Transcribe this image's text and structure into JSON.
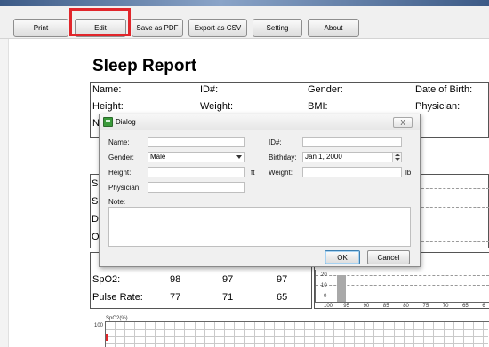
{
  "toolbar": {
    "print": "Print",
    "edit": "Edit",
    "save_pdf": "Save as PDF",
    "export_csv": "Export as CSV",
    "setting": "Setting",
    "about": "About"
  },
  "report": {
    "title": "Sleep Report",
    "info": {
      "name": "Name:",
      "id": "ID#:",
      "gender": "Gender:",
      "dob": "Date of Birth:",
      "height": "Height:",
      "weight": "Weight:",
      "bmi": "BMI:",
      "physician": "Physician:",
      "note_partial": "N"
    },
    "left_partials": [
      "S",
      "S",
      "D",
      "O"
    ],
    "table": {
      "rows": [
        {
          "label": "SpO2:",
          "values": [
            "98",
            "97",
            "97"
          ]
        },
        {
          "label": "Pulse Rate:",
          "values": [
            "77",
            "71",
            "65"
          ]
        }
      ]
    },
    "bar_chart": {
      "type": "bar",
      "y_ticks": [
        "20",
        "10",
        "0"
      ],
      "x_ticks": [
        "100",
        "95",
        "90",
        "85",
        "80",
        "75",
        "70",
        "65",
        "6"
      ]
    },
    "spo2_chart": {
      "ylabel": "SpO2(%)",
      "y_tick_top": "100"
    }
  },
  "dialog": {
    "title": "Dialog",
    "close_glyph": "X",
    "fields": {
      "name_label": "Name:",
      "id_label": "ID#:",
      "gender_label": "Gender:",
      "gender_value": "Male",
      "birthday_label": "Birthday:",
      "birthday_value": "Jan 1, 2000",
      "height_label": "Height:",
      "height_unit": "ft",
      "weight_label": "Weight:",
      "weight_unit": "lb",
      "physician_label": "Physician:",
      "note_label": "Note:"
    },
    "ok": "OK",
    "cancel": "Cancel"
  },
  "colors": {
    "highlight": "#e1262b",
    "bar_fill": "#a9a9a9"
  }
}
